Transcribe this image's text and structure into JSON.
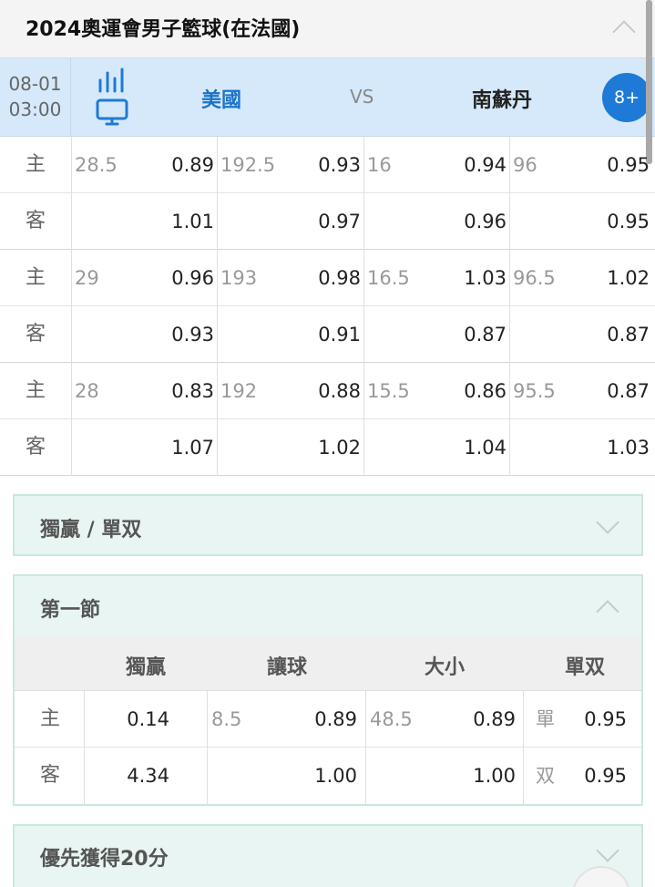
{
  "header": {
    "title": "2024奧運會男子籃球(在法國)"
  },
  "match": {
    "date": "08-01",
    "time": "03:00",
    "home": "美國",
    "vs": "VS",
    "away": "南蘇丹",
    "more": "8+"
  },
  "odds_groups": [
    {
      "home_label": "主",
      "away_label": "客",
      "handicap": "28.5",
      "handicap_home": "0.89",
      "handicap_away": "1.01",
      "total": "192.5",
      "total_home": "0.93",
      "total_away": "0.97",
      "half_handicap": "16",
      "half_handicap_home": "0.94",
      "half_handicap_away": "0.96",
      "half_total": "96",
      "half_total_home": "0.95",
      "half_total_away": "0.95"
    },
    {
      "home_label": "主",
      "away_label": "客",
      "handicap": "29",
      "handicap_home": "0.96",
      "handicap_away": "0.93",
      "total": "193",
      "total_home": "0.98",
      "total_away": "0.91",
      "half_handicap": "16.5",
      "half_handicap_home": "1.03",
      "half_handicap_away": "0.87",
      "half_total": "96.5",
      "half_total_home": "1.02",
      "half_total_away": "0.87"
    },
    {
      "home_label": "主",
      "away_label": "客",
      "handicap": "28",
      "handicap_home": "0.83",
      "handicap_away": "1.07",
      "total": "192",
      "total_home": "0.88",
      "total_away": "1.02",
      "half_handicap": "15.5",
      "half_handicap_home": "0.86",
      "half_handicap_away": "1.04",
      "half_total": "95.5",
      "half_total_home": "0.87",
      "half_total_away": "1.03"
    }
  ],
  "panels": {
    "winner_oddeven": "獨贏 / 單双",
    "first_quarter": "第一節",
    "first_to_20": "優先獲得20分"
  },
  "first_quarter": {
    "headers": {
      "moneyline": "獨贏",
      "handicap": "讓球",
      "total": "大小",
      "odd_even": "單双"
    },
    "home": {
      "label": "主",
      "moneyline": "0.14",
      "handicap_line": "8.5",
      "handicap_odds": "0.89",
      "total_line": "48.5",
      "total_odds": "0.89",
      "oe_label": "單",
      "oe_odds": "0.95"
    },
    "away": {
      "label": "客",
      "moneyline": "4.34",
      "handicap_odds": "1.00",
      "total_odds": "1.00",
      "oe_label": "双",
      "oe_odds": "0.95"
    }
  },
  "colors": {
    "accent": "#1a73c9",
    "match_bg": "#d5e9fb",
    "panel_bg": "#e8f5f2",
    "badge": "#1e7ad6"
  },
  "icons": {
    "stats": "bar-chart-icon",
    "tv": "tv-icon"
  }
}
